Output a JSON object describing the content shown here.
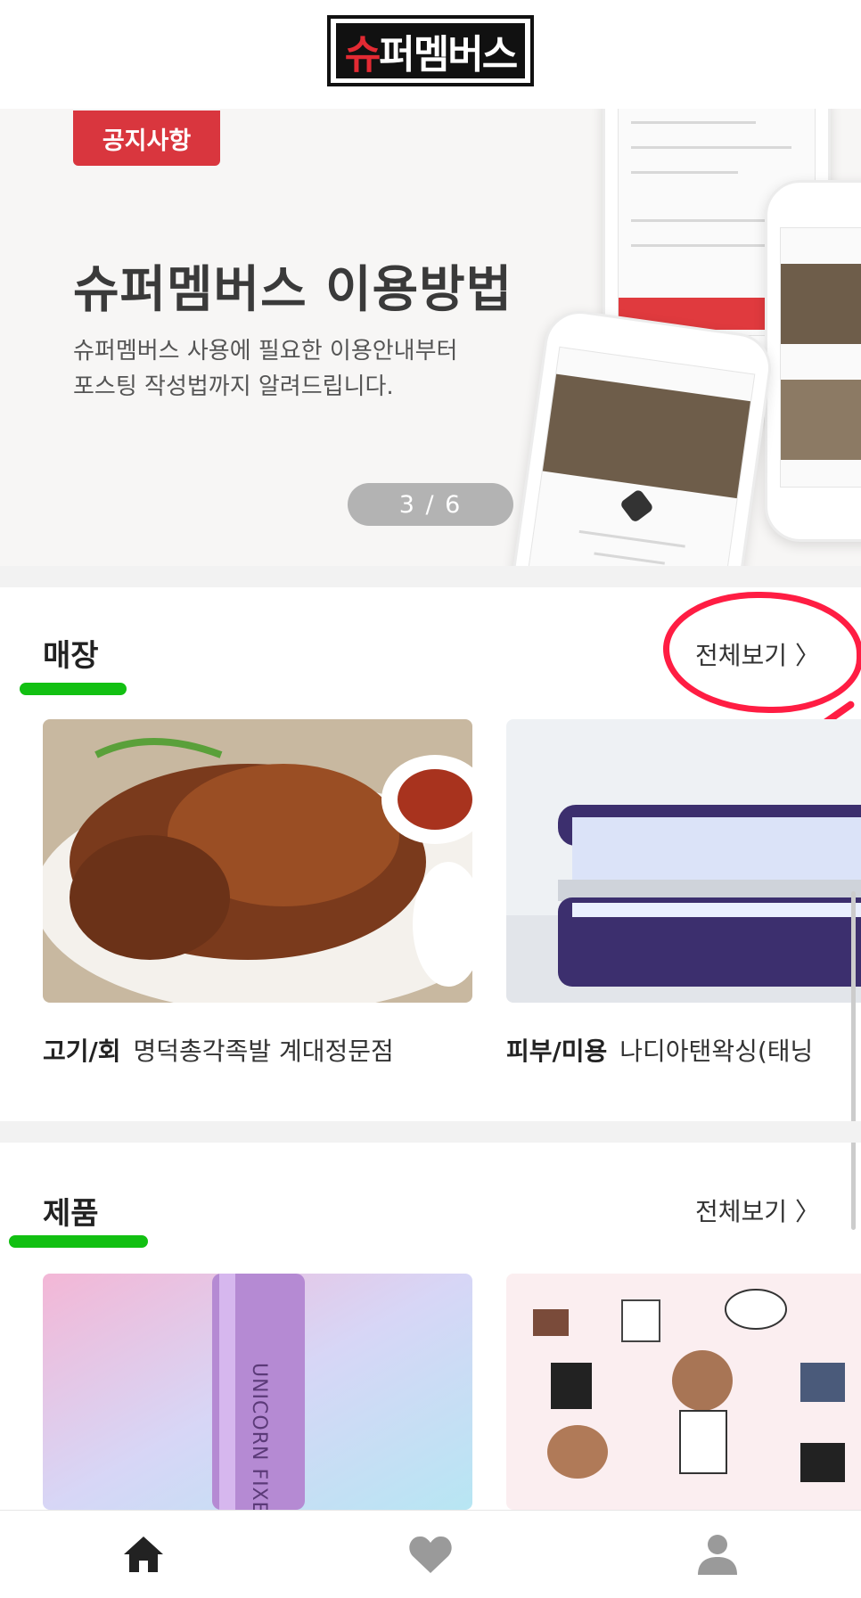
{
  "header": {
    "logo_text": "슈퍼멤버스",
    "logo_first_char_color": "#e22a33"
  },
  "banner": {
    "badge_label": "공지사항",
    "title": "슈퍼멤버스 이용방법",
    "description": "슈퍼멤버스 사용에 필요한 이용안내부터\n포스팅 작성법까지 알려드립니다.",
    "pager_text": "3 / 6",
    "current_slide": 3,
    "total_slides": 6,
    "illustration": "phone-mockups"
  },
  "stores_section": {
    "title": "매장",
    "view_all_label": "전체보기 〉",
    "items": [
      {
        "category": "고기/회",
        "name": "명덕총각족발 계대정문점",
        "image": "braised-pork-hocks-photo"
      },
      {
        "category": "피부/미용",
        "name": "나디아탠왁싱(태닝",
        "image": "tanning-bed-photo"
      }
    ]
  },
  "products_section": {
    "title": "제품",
    "view_all_label": "전체보기 〉",
    "items": [
      {
        "image": "unicorn-fixer-bottle-photo",
        "bottle_text": "UNICORN FIXER"
      },
      {
        "image": "paper-doll-illustration"
      }
    ]
  },
  "bottom_nav": [
    {
      "icon": "home-icon"
    },
    {
      "icon": "heart-icon"
    },
    {
      "icon": "user-icon"
    }
  ],
  "colors": {
    "accent_red": "#d9363e",
    "annotation_red": "#ff1d43",
    "annotation_green": "#12c012"
  }
}
